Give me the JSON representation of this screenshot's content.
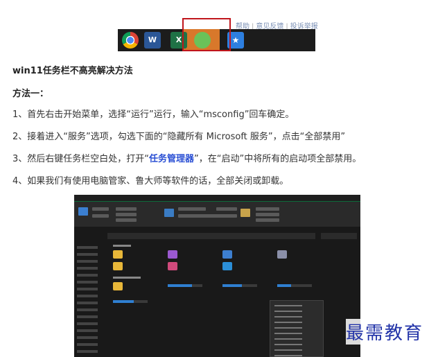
{
  "taskbar_shot": {
    "links": [
      "帮助",
      "意见反馈",
      "投诉举报"
    ],
    "word_label": "W",
    "excel_label": "X"
  },
  "article": {
    "title": "win11任务栏不高亮解决方法",
    "method_heading": "方法一：",
    "step1": "1、首先右击开始菜单，选择“运行”运行，输入“msconfig”回车确定。",
    "step2": "2、接着进入“服务”选项，勾选下面的“隐藏所有 Microsoft 服务”，点击“全部禁用”",
    "step3_prefix": "3、然后右键任务栏空白处，打开“",
    "step3_link": "任务管理器",
    "step3_suffix": "”，在“启动”中将所有的启动项全部禁用。",
    "step4": "4、如果我们有使用电脑管家、鲁大师等软件的话，全部关闭或卸载。"
  },
  "watermark": "最需教育",
  "colors": {
    "link": "#2a4fd4",
    "highlight_box": "#c0151b",
    "wechat_tile": "#d8782b",
    "taskbar": "#1c1c1c"
  }
}
